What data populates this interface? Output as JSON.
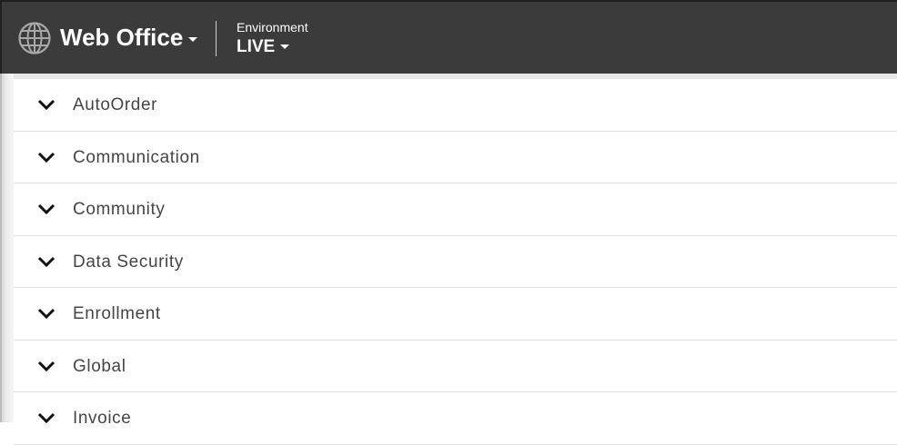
{
  "header": {
    "app_title": "Web Office",
    "environment_label": "Environment",
    "environment_value": "LIVE"
  },
  "sections": [
    {
      "label": "AutoOrder"
    },
    {
      "label": "Communication"
    },
    {
      "label": "Community"
    },
    {
      "label": "Data Security"
    },
    {
      "label": "Enrollment"
    },
    {
      "label": "Global"
    },
    {
      "label": "Invoice"
    }
  ],
  "icons": {
    "app": "globe-icon",
    "dropdown": "caret-down-icon",
    "section_toggle": "chevron-down-icon"
  },
  "colors": {
    "header_bg": "#3b3b3b",
    "header_text": "#ffffff",
    "item_text": "#454545",
    "divider": "#e2e2e2"
  }
}
